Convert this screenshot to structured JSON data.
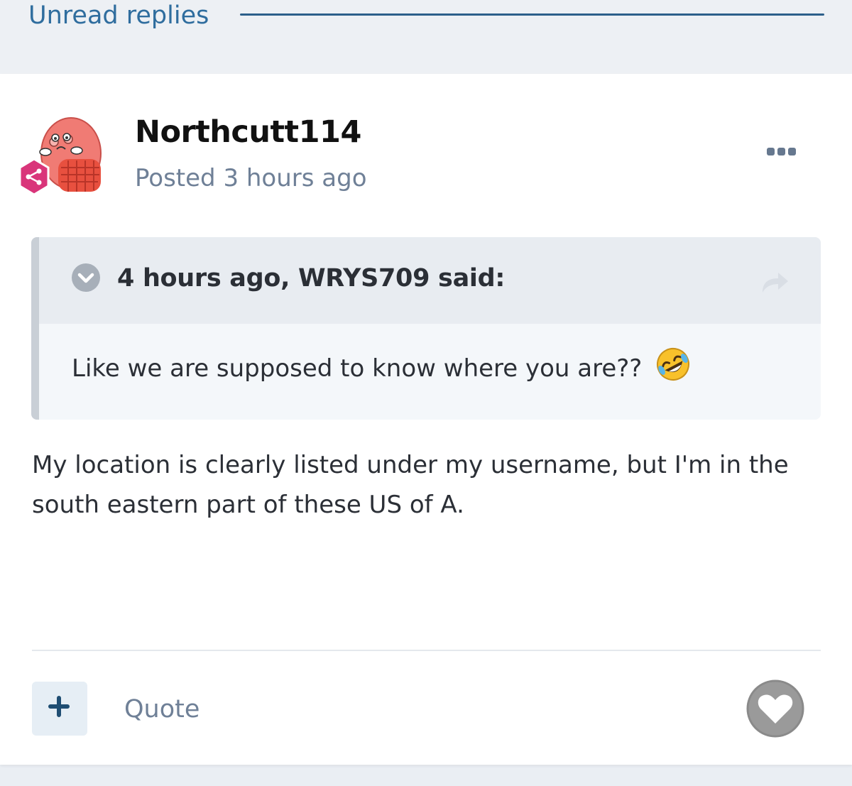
{
  "header": {
    "tab_label": "Unread replies"
  },
  "post": {
    "author": "Northcutt114",
    "posted_time": "Posted 3 hours ago",
    "quote": {
      "citation": "4 hours ago, WRYS709 said:",
      "text": "Like we are supposed to know where you are??"
    },
    "body": "My location is clearly listed under my username, but I'm in the south eastern part of these US of A.",
    "actions": {
      "quote_label": "Quote"
    }
  },
  "colors": {
    "accent": "#2f6d9e",
    "badge": "#d9357a",
    "avatar": "#f07b74"
  }
}
